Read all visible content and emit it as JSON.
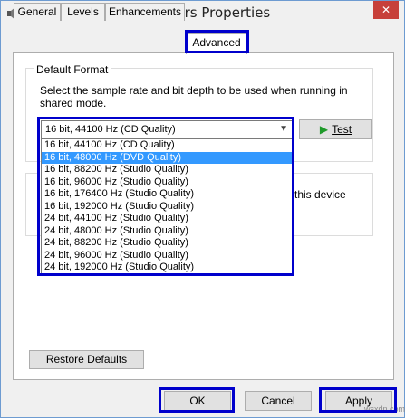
{
  "window": {
    "title": "Speakers Properties",
    "close_label": "✕"
  },
  "tabs": [
    {
      "label": "General"
    },
    {
      "label": "Levels"
    },
    {
      "label": "Enhancements"
    },
    {
      "label": "Advanced"
    }
  ],
  "default_format": {
    "group_title": "Default Format",
    "description": "Select the sample rate and bit depth to be used when running in shared mode.",
    "selected_value": "16 bit, 44100 Hz (CD Quality)",
    "test_label": "Test",
    "test_label_prefix": "",
    "options": [
      "16 bit, 44100 Hz (CD Quality)",
      "16 bit, 48000 Hz (DVD Quality)",
      "16 bit, 88200 Hz (Studio Quality)",
      "16 bit, 96000 Hz (Studio Quality)",
      "16 bit, 176400 Hz (Studio Quality)",
      "16 bit, 192000 Hz (Studio Quality)",
      "24 bit, 44100 Hz (Studio Quality)",
      "24 bit, 48000 Hz (Studio Quality)",
      "24 bit, 88200 Hz (Studio Quality)",
      "24 bit, 96000 Hz (Studio Quality)",
      "24 bit, 192000 Hz (Studio Quality)"
    ],
    "highlighted_index": 1
  },
  "exclusive_mode": {
    "partial_text": "this device"
  },
  "buttons": {
    "restore_defaults": "Restore Defaults",
    "ok": "OK",
    "cancel": "Cancel",
    "apply": "Apply"
  },
  "watermark": "wsxdn.com",
  "icons": {
    "window": "speaker-icon",
    "test": "play-icon",
    "dropdown": "chevron-down-icon"
  },
  "colors": {
    "highlight_box": "#0000cc",
    "selection": "#3399ff",
    "close_button": "#c7403a",
    "play_icon": "#1f9a2a"
  }
}
